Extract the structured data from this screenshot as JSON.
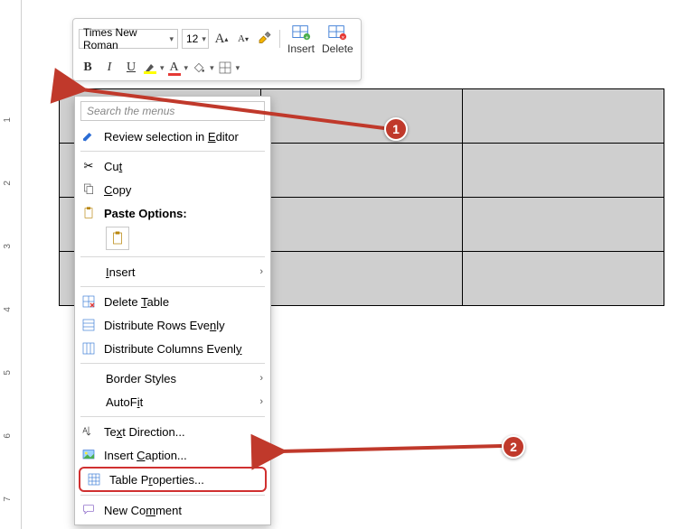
{
  "toolbar": {
    "font_name": "Times New Roman",
    "font_size": "12",
    "grow_font": "A",
    "shrink_font": "A",
    "bold": "B",
    "italic": "I",
    "underline": "U",
    "font_color_letter": "A",
    "highlight_letter": "A",
    "insert_label": "Insert",
    "delete_label": "Delete"
  },
  "context_menu": {
    "search_placeholder": "Search the menus",
    "review": "Review selection in Editor",
    "cut": "Cut",
    "copy": "Copy",
    "paste_options": "Paste Options:",
    "insert": "Insert",
    "delete_table": "Delete Table",
    "dist_rows": "Distribute Rows Evenly",
    "dist_cols": "Distribute Columns Evenly",
    "border_styles": "Border Styles",
    "autofit": "AutoFit",
    "text_direction": "Text Direction...",
    "insert_caption": "Insert Caption...",
    "table_properties": "Table Properties...",
    "new_comment": "New Comment"
  },
  "ruler_numbers": [
    "1",
    "2",
    "3",
    "4",
    "5",
    "6",
    "7"
  ],
  "callouts": {
    "c1": "1",
    "c2": "2"
  }
}
